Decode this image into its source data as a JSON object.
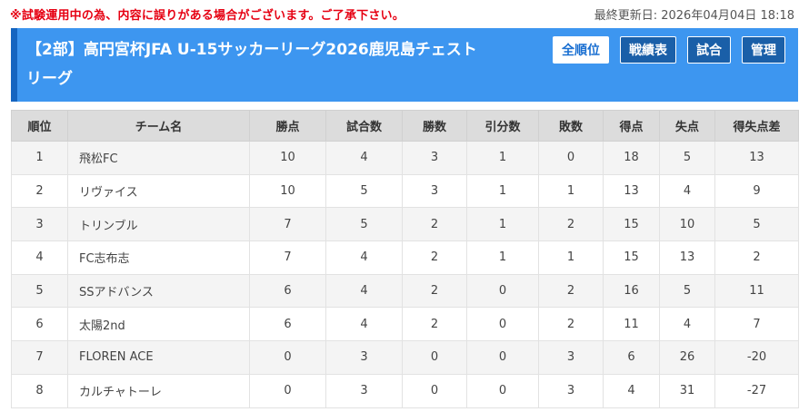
{
  "notice": "※試験運用中の為、内容に誤りがある場合がございます。ご了承下さい。",
  "updated": {
    "label": "最終更新日:",
    "datetime": "2026年04月04日 18:18"
  },
  "header": {
    "title": "【2部】高円宮杯JFA U-15サッカーリーグ2026鹿児島チェストリーグ",
    "accent_color": "#3d96f0"
  },
  "nav": {
    "standings": "全順位",
    "results": "戦績表",
    "matches": "試合",
    "admin": "管理"
  },
  "table": {
    "headers": [
      "順位",
      "チーム名",
      "勝点",
      "試合数",
      "勝数",
      "引分数",
      "敗数",
      "得点",
      "失点",
      "得失点差"
    ],
    "rows": [
      [
        "1",
        "飛松FC",
        "10",
        "4",
        "3",
        "1",
        "0",
        "18",
        "5",
        "13"
      ],
      [
        "2",
        "リヴァイス",
        "10",
        "5",
        "3",
        "1",
        "1",
        "13",
        "4",
        "9"
      ],
      [
        "3",
        "トリンブル",
        "7",
        "5",
        "2",
        "1",
        "2",
        "15",
        "10",
        "5"
      ],
      [
        "4",
        "FC志布志",
        "7",
        "4",
        "2",
        "1",
        "1",
        "15",
        "13",
        "2"
      ],
      [
        "5",
        "SSアドバンス",
        "6",
        "4",
        "2",
        "0",
        "2",
        "16",
        "5",
        "11"
      ],
      [
        "6",
        "太陽2nd",
        "6",
        "4",
        "2",
        "0",
        "2",
        "11",
        "4",
        "7"
      ],
      [
        "7",
        "FLOREN ACE",
        "0",
        "3",
        "0",
        "0",
        "3",
        "6",
        "26",
        "-20"
      ],
      [
        "8",
        "カルチャトーレ",
        "0",
        "3",
        "0",
        "0",
        "3",
        "4",
        "31",
        "-27"
      ]
    ]
  }
}
